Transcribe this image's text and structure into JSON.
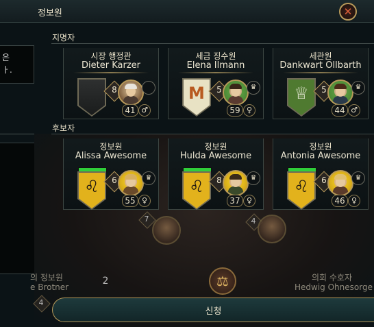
{
  "window": {
    "title": "정보원"
  },
  "left_panel": {
    "lines": [
      "은",
      "ㅏ."
    ]
  },
  "appointed": {
    "label": "지명자",
    "cards": [
      {
        "role": "시장 행정관",
        "name": "Dieter Karzer",
        "rank": "8",
        "age": "41",
        "gender": "♂",
        "shield": "empty",
        "shield_glyph": "",
        "badge": ""
      },
      {
        "role": "세금 징수원",
        "name": "Elena Ilmann",
        "rank": "5",
        "age": "59",
        "gender": "♀",
        "shield": "m",
        "shield_glyph": "M",
        "badge": "♛"
      },
      {
        "role": "세관원",
        "name": "Dankwart Ollbarth",
        "rank": "5",
        "age": "44",
        "gender": "♂",
        "shield": "crown",
        "shield_glyph": "♕",
        "badge": "♛"
      }
    ]
  },
  "candidates": {
    "label": "후보자",
    "cards": [
      {
        "role": "정보원",
        "name": "Alissa Awesome",
        "rank": "6",
        "age": "55",
        "gender": "♀",
        "shield_glyph": "♌",
        "badge": "♛"
      },
      {
        "role": "정보원",
        "name": "Hulda Awesome",
        "rank": "8",
        "age": "37",
        "gender": "♀",
        "shield_glyph": "♌",
        "badge": "♛"
      },
      {
        "role": "정보원",
        "name": "Antonia Awesome",
        "rank": "6",
        "age": "46",
        "gender": "♀",
        "shield_glyph": "♌",
        "badge": "♛"
      }
    ]
  },
  "background": {
    "left_role": "의 정보원",
    "left_name": "e Brotner",
    "right_role": "의회 수호자",
    "right_name": "Hedwig Ohnesorge",
    "rank_left": "7",
    "rank_right": "4",
    "rank_bottom": "2",
    "rank_bottom_left": "4"
  },
  "actions": {
    "apply_label": "신청"
  },
  "colors": {
    "accent_gold": "#b89a5a",
    "close_red": "#e0603a",
    "health_green": "#2fcf3a"
  }
}
